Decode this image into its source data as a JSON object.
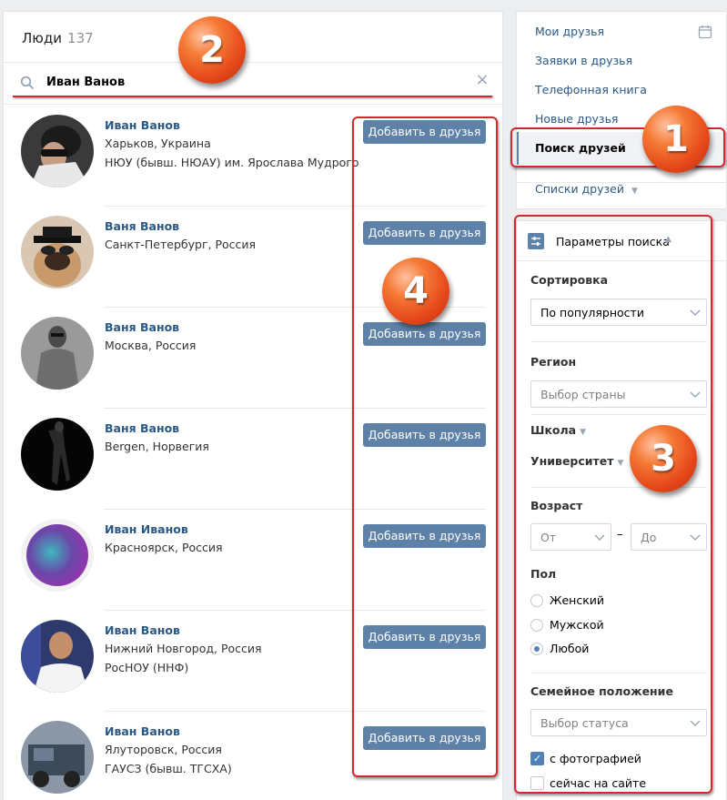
{
  "people": {
    "title": "Люди",
    "count": "137",
    "search_value": "Иван Ванов",
    "add_label": "Добавить в друзья",
    "results": [
      {
        "name": "Иван Ванов",
        "line1": "Харьков, Украина",
        "line2": "НЮУ (бывш. НЮАУ) им. Ярослава Мудрого"
      },
      {
        "name": "Ваня Ванов",
        "line1": "Санкт-Петербург, Россия",
        "line2": ""
      },
      {
        "name": "Ваня Ванов",
        "line1": "Москва, Россия",
        "line2": ""
      },
      {
        "name": "Ваня Ванов",
        "line1": "Bergen, Норвегия",
        "line2": ""
      },
      {
        "name": "Иван Иванов",
        "line1": "Красноярск, Россия",
        "line2": ""
      },
      {
        "name": "Иван Ванов",
        "line1": "Нижний Новгород, Россия",
        "line2": "РосНОУ (ННФ)"
      },
      {
        "name": "Иван Ванов",
        "line1": "Ялуторовск, Россия",
        "line2": "ГАУСЗ (бывш. ТГСХА)"
      }
    ]
  },
  "nav": {
    "my_friends": "Мои друзья",
    "requests": "Заявки в друзья",
    "phonebook": "Телефонная книга",
    "new_friends": "Новые друзья",
    "search_friends": "Поиск друзей",
    "friend_lists": "Списки друзей"
  },
  "params": {
    "title": "Параметры поиска",
    "sort_label": "Сортировка",
    "sort_value": "По популярности",
    "region_label": "Регион",
    "region_placeholder": "Выбор страны",
    "school_label": "Школа",
    "university_label": "Университет",
    "age_label": "Возраст",
    "age_from": "От",
    "age_dash": "–",
    "age_to": "До",
    "sex_label": "Пол",
    "sex_female": "Женский",
    "sex_male": "Мужской",
    "sex_any": "Любой",
    "family_label": "Семейное положение",
    "family_placeholder": "Выбор статуса",
    "with_photo": "с фотографией",
    "online_now": "сейчас на сайте"
  },
  "annotations": {
    "badge_1": "1",
    "badge_2": "2",
    "badge_3": "3",
    "badge_4": "4",
    "color": "#d7262c"
  },
  "colors": {
    "accent": "#5e81a8",
    "link": "#2a5885",
    "background": "#edeef0"
  }
}
